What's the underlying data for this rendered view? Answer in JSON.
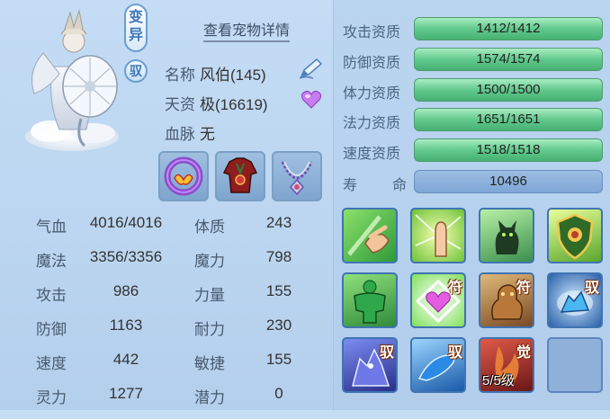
{
  "header": {
    "variant_tag": "变异",
    "tame_tag": "驭",
    "detail_link": "查看宠物详情"
  },
  "info": {
    "name_label": "名称",
    "name_value": "风伯(145)",
    "talent_label": "天资",
    "talent_value": "极(16619)",
    "bloodline_label": "血脉",
    "bloodline_value": "无",
    "edit_icon": "pencil-icon",
    "favorite_icon": "heart-icon",
    "favorite_color": "#c77df0"
  },
  "equipment": [
    {
      "name": "ring-equipment-icon"
    },
    {
      "name": "armor-equipment-icon"
    },
    {
      "name": "necklace-equipment-icon"
    }
  ],
  "stats": [
    {
      "label": "气血",
      "value": "4016/4016",
      "label2": "体质",
      "value2": "243"
    },
    {
      "label": "魔法",
      "value": "3356/3356",
      "label2": "魔力",
      "value2": "798"
    },
    {
      "label": "攻击",
      "value": "986",
      "label2": "力量",
      "value2": "155"
    },
    {
      "label": "防御",
      "value": "1163",
      "label2": "耐力",
      "value2": "230"
    },
    {
      "label": "速度",
      "value": "442",
      "label2": "敏捷",
      "value2": "155"
    },
    {
      "label": "灵力",
      "value": "1277",
      "label2": "潜力",
      "value2": "0"
    }
  ],
  "aptitudes": [
    {
      "label": "攻击资质",
      "value": "1412/1412",
      "fill": 1.0
    },
    {
      "label": "防御资质",
      "value": "1574/1574",
      "fill": 1.0
    },
    {
      "label": "体力资质",
      "value": "1500/1500",
      "fill": 1.0
    },
    {
      "label": "法力资质",
      "value": "1651/1651",
      "fill": 1.0
    },
    {
      "label": "速度资质",
      "value": "1518/1518",
      "fill": 1.0
    }
  ],
  "life": {
    "label_a": "寿",
    "label_b": "命",
    "value": "10496"
  },
  "skills": [
    {
      "name": "skill-hand-wave-icon",
      "badge": ""
    },
    {
      "name": "skill-hand-palm-icon",
      "badge": ""
    },
    {
      "name": "skill-black-cat-icon",
      "badge": ""
    },
    {
      "name": "skill-shield-icon",
      "badge": ""
    },
    {
      "name": "skill-green-strongman-icon",
      "badge": ""
    },
    {
      "name": "skill-heart-icon",
      "badge": "符"
    },
    {
      "name": "skill-golden-beast-icon",
      "badge": "符"
    },
    {
      "name": "skill-blue-wolf-icon",
      "badge": "驭"
    },
    {
      "name": "skill-purple-wolf-icon",
      "badge": "驭"
    },
    {
      "name": "skill-blue-wolf-leap-icon",
      "badge": "驭"
    },
    {
      "name": "skill-awaken-icon",
      "badge": "觉",
      "level": "5/5级"
    },
    {
      "name": "skill-empty-slot",
      "badge": ""
    }
  ],
  "colors": {
    "bar_green": "#58c184",
    "panel_blue": "#bcd6f1",
    "accent_blue": "#3d78b8"
  }
}
